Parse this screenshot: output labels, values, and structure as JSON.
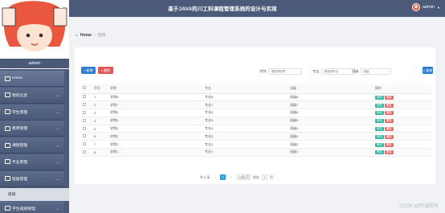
{
  "header": {
    "title": "基于JAVA的川工科课程管理系统的设计与实现",
    "user": "admin",
    "menu_icon": "hamburger-icon"
  },
  "sidebar": {
    "username": "admin",
    "items": [
      {
        "label": "Home",
        "icon": "home-icon"
      },
      {
        "label": "我的信息",
        "icon": "info-icon"
      },
      {
        "label": "学生管理",
        "icon": "student-icon"
      },
      {
        "label": "教师管理",
        "icon": "teacher-icon"
      },
      {
        "label": "课程管理",
        "icon": "course-icon"
      },
      {
        "label": "专业管理",
        "icon": "major-icon"
      },
      {
        "label": "班级管理",
        "icon": "class-icon"
      }
    ],
    "subitem": "班级",
    "last_item": "学生成绩管理"
  },
  "breadcrumb": {
    "home": "Home",
    "current": "班级"
  },
  "toolbar": {
    "add_label": "新增",
    "delete_label": "删除",
    "search_label": "查询"
  },
  "filters": {
    "f1_label": "学院",
    "f1_placeholder": "请选择学院",
    "f2_label": "专业",
    "f2_placeholder": "请选择专业",
    "f3_label": "班级",
    "f3_placeholder": "班级"
  },
  "table": {
    "headers": [
      "",
      "序号",
      "学院",
      "专业",
      "班级",
      "操作"
    ],
    "rows": [
      [
        "1",
        "学院8",
        "专业8",
        "班级8"
      ],
      [
        "2",
        "学院7",
        "专业7",
        "班级7"
      ],
      [
        "3",
        "学院6",
        "专业6",
        "班级6"
      ],
      [
        "4",
        "学院5",
        "专业5",
        "班级5"
      ],
      [
        "5",
        "学院4",
        "专业4",
        "班级4"
      ],
      [
        "6",
        "学院3",
        "专业3",
        "班级3"
      ],
      [
        "7",
        "学院2",
        "专业2",
        "班级2"
      ],
      [
        "8",
        "学院1",
        "专业1",
        "班级1"
      ]
    ],
    "edit_label": "修改",
    "delete_label": "删除"
  },
  "pager": {
    "total": "共 8 条",
    "prev": "‹",
    "page": "1",
    "next": "›",
    "dash": "下一页",
    "per_page": "10条/页",
    "goto": "前往",
    "goto_page": "1",
    "unit": "页"
  },
  "watermark": "CSDN @阿诚程序",
  "colors": {
    "primary": "#2f7fd1",
    "danger": "#e05a5a",
    "sidebar": "#4a5a78",
    "edit": "#36b4a6"
  }
}
